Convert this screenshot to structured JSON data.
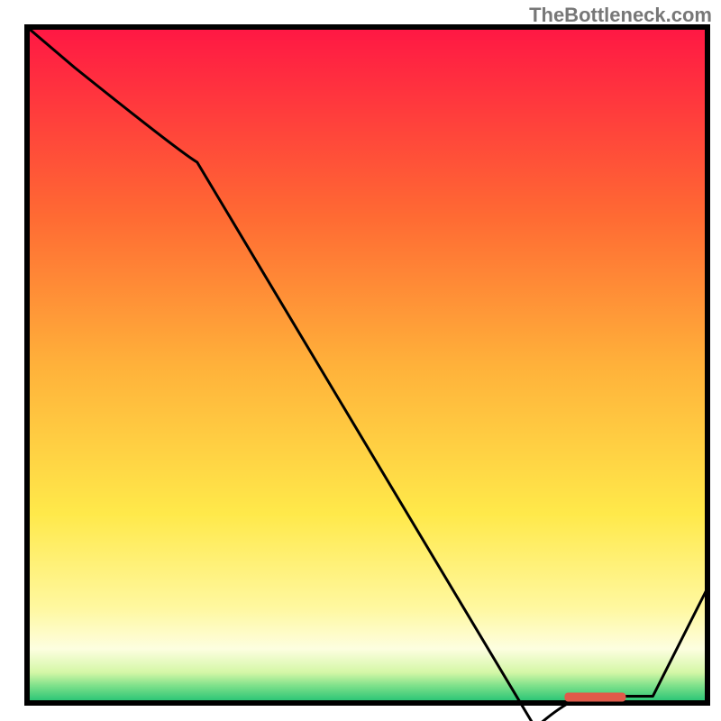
{
  "watermark": "TheBottleneck.com",
  "chart_data": {
    "type": "line",
    "title": "",
    "xlabel": "",
    "ylabel": "",
    "xlim": [
      0,
      100
    ],
    "ylim": [
      0,
      100
    ],
    "annotation_label": "",
    "annotation_x_range": [
      79,
      88
    ],
    "series": [
      {
        "name": "curve",
        "x": [
          0,
          7,
          25,
          80,
          88,
          100
        ],
        "y": [
          100,
          94,
          80,
          1,
          1,
          17
        ]
      }
    ],
    "gradient_stops": [
      {
        "offset": 0,
        "color": "#ff1744"
      },
      {
        "offset": 0.28,
        "color": "#ff6a33"
      },
      {
        "offset": 0.5,
        "color": "#ffb13a"
      },
      {
        "offset": 0.72,
        "color": "#ffe94a"
      },
      {
        "offset": 0.86,
        "color": "#fff8a0"
      },
      {
        "offset": 0.92,
        "color": "#fdfee0"
      },
      {
        "offset": 0.955,
        "color": "#d4f7a6"
      },
      {
        "offset": 0.975,
        "color": "#7ce08a"
      },
      {
        "offset": 1.0,
        "color": "#1fc173"
      }
    ]
  }
}
